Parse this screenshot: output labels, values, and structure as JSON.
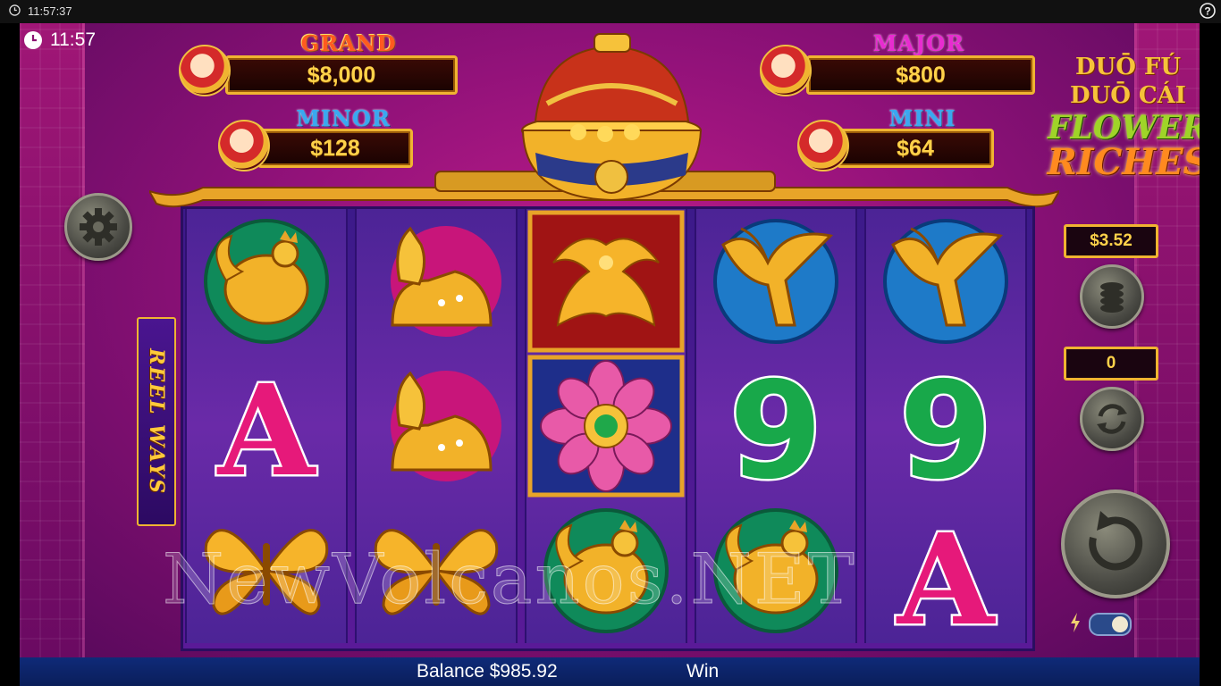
{
  "system_bar": {
    "time": "11:57:37"
  },
  "game_clock": {
    "time": "11:57"
  },
  "jackpots": {
    "grand": {
      "label": "GRAND",
      "value": "$8,000"
    },
    "major": {
      "label": "MAJOR",
      "value": "$800"
    },
    "minor": {
      "label": "MINOR",
      "value": "$128"
    },
    "mini": {
      "label": "MINI",
      "value": "$64"
    }
  },
  "logo": {
    "line1": "DUŌ FÚ",
    "line2": "DUŌ CÁI",
    "line3": "FLOWER",
    "line4": "RICHES"
  },
  "reel_badge": {
    "text": "REEL WAYS"
  },
  "controls": {
    "bet": "$3.52",
    "autoplay_count": "0"
  },
  "watermark": {
    "text": "NewVolcanos.NET"
  },
  "footer": {
    "balance": "Balance $985.92",
    "win_label": "Win"
  },
  "reels": [
    [
      "rooster",
      "A",
      "butterfly"
    ],
    [
      "deer",
      "deer",
      "butterfly"
    ],
    [
      "phoenix",
      "lotus",
      "rooster"
    ],
    [
      "crane",
      "9",
      "rooster"
    ],
    [
      "crane",
      "9",
      "A"
    ]
  ],
  "colors": {
    "accent_gold": "#f0b431",
    "background_magenta": "#a0147e",
    "footer_blue": "#0f2a78"
  }
}
